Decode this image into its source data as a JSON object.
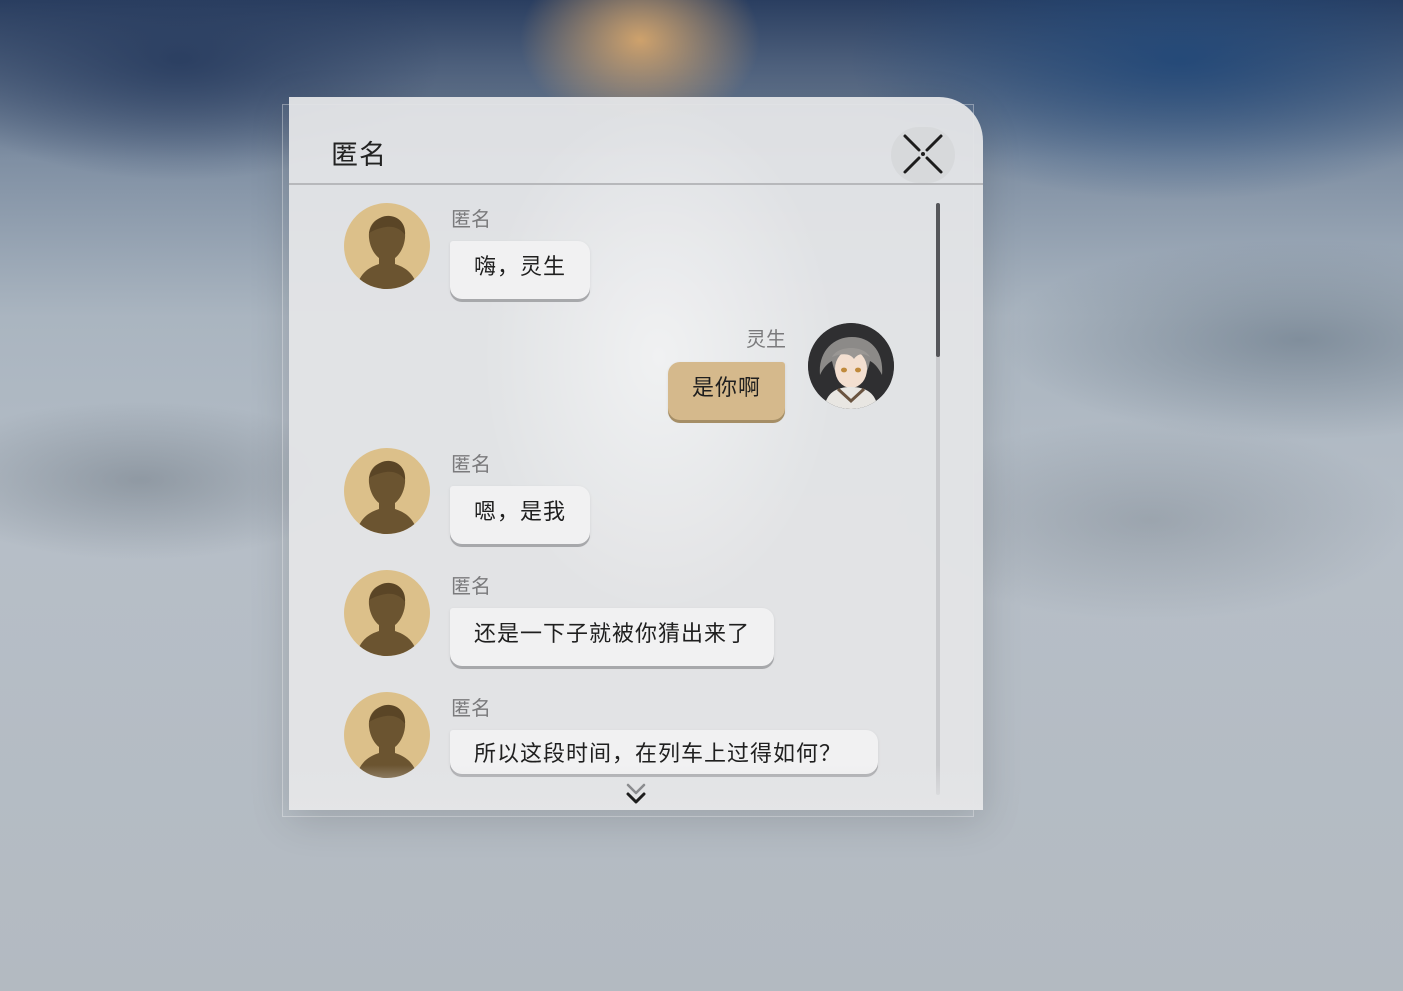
{
  "dialog": {
    "title": "匿名",
    "close_icon": "close-icon"
  },
  "messages": [
    {
      "sender": "匿名",
      "side": "left",
      "avatar": "silhouette-avatar",
      "text": "嗨，灵生"
    },
    {
      "sender": "灵生",
      "side": "right",
      "avatar": "character-avatar",
      "text": "是你啊"
    },
    {
      "sender": "匿名",
      "side": "left",
      "avatar": "silhouette-avatar",
      "text": "嗯，是我"
    },
    {
      "sender": "匿名",
      "side": "left",
      "avatar": "silhouette-avatar",
      "text": "还是一下子就被你猜出来了"
    },
    {
      "sender": "匿名",
      "side": "left",
      "avatar": "silhouette-avatar",
      "text": "所以这段时间，在列车上过得如何？"
    }
  ],
  "scroll": {
    "more_icon": "chevron-double-down-icon"
  },
  "colors": {
    "panel": "#e4e5e7",
    "left_bubble": "#f1f1f2",
    "right_bubble": "#d5b98c",
    "avatar_bg": "#dcc08a",
    "silhouette": "#6b5430"
  }
}
